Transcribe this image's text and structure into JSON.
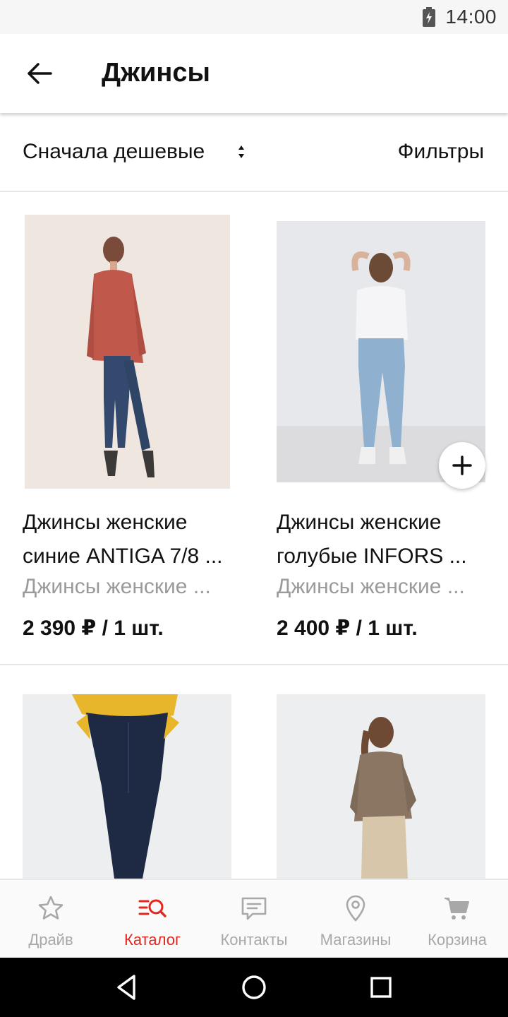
{
  "status_bar": {
    "time": "14:00",
    "battery_icon": "battery-charging-icon"
  },
  "app_bar": {
    "title": "Джинсы",
    "back_icon": "arrow-back-icon"
  },
  "toolbar": {
    "sort_label": "Сначала дешевые",
    "sort_icon": "sort-arrows-icon",
    "filters_label": "Фильтры"
  },
  "products": [
    {
      "name_line1": "Джинсы женские",
      "name_line2": "синие ANTIGA 7/8 ...",
      "description": "Джинсы женские ...",
      "price": "2 390 ₽ / 1 шт.",
      "image": "woman-in-rust-shirt-and-blue-jeans"
    },
    {
      "name_line1": "Джинсы женские",
      "name_line2": "голубые INFORS ...",
      "description": "Джинсы женские ...",
      "price": "2 400 ₽ / 1 шт.",
      "image": "woman-in-white-tshirt-and-light-jeans"
    },
    {
      "image": "woman-in-yellow-sweater-and-dark-jeans"
    },
    {
      "image": "woman-in-brown-shirt-and-beige-trousers"
    }
  ],
  "add_button_icon": "plus-icon",
  "bottom_nav": [
    {
      "label": "Драйв",
      "icon": "star-icon",
      "active": false
    },
    {
      "label": "Каталог",
      "icon": "catalog-search-icon",
      "active": true
    },
    {
      "label": "Контакты",
      "icon": "chat-icon",
      "active": false
    },
    {
      "label": "Магазины",
      "icon": "map-pin-icon",
      "active": false
    },
    {
      "label": "Корзина",
      "icon": "cart-icon",
      "active": false
    }
  ],
  "colors": {
    "accent": "#e5261e",
    "inactive": "#a8a8a8"
  }
}
